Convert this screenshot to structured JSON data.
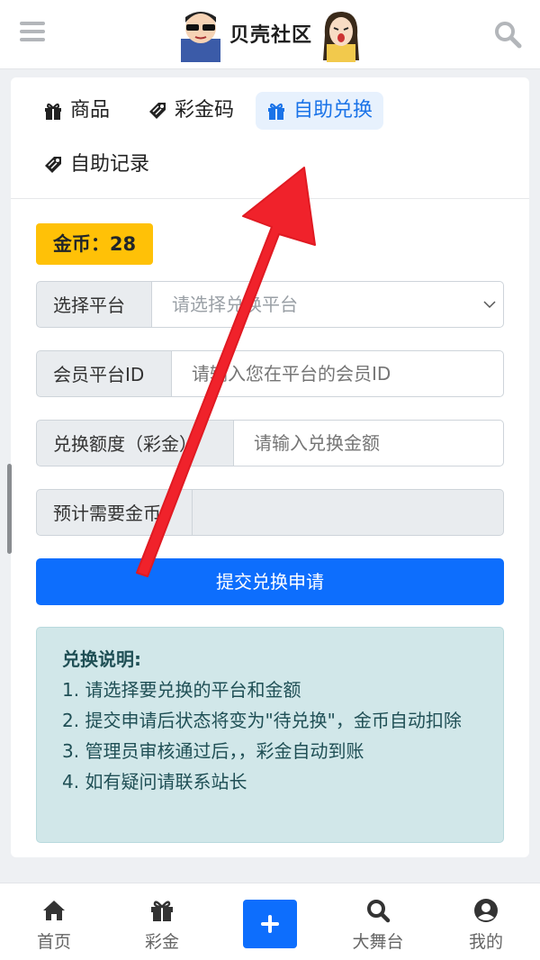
{
  "header": {
    "logo_text": "贝壳社区",
    "menu_icon": "hamburger-icon",
    "search_icon": "search-icon"
  },
  "tabs": [
    {
      "label": "商品",
      "icon": "gift-icon"
    },
    {
      "label": "彩金码",
      "icon": "ticket-icon"
    },
    {
      "label": "自助兑换",
      "icon": "gift-icon",
      "active": true
    },
    {
      "label": "自助记录",
      "icon": "ticket-icon"
    }
  ],
  "coin_badge": "金币：28",
  "form": {
    "platform": {
      "label": "选择平台",
      "placeholder": "请选择兑换平台"
    },
    "member_id": {
      "label": "会员平台ID",
      "placeholder": "请输入您在平台的会员ID"
    },
    "amount": {
      "label": "兑换额度（彩金）",
      "placeholder": "请输入兑换金额"
    },
    "coins_needed": {
      "label": "预计需要金币",
      "value": ""
    }
  },
  "submit_label": "提交兑换申请",
  "notice": {
    "title": "兑换说明:",
    "lines": [
      "1. 请选择要兑换的平台和金额",
      "2. 提交申请后状态将变为\"待兑换\"，金币自动扣除",
      "3. 管理员审核通过后，，彩金自动到账",
      "4. 如有疑问请联系站长"
    ]
  },
  "bottom_nav": [
    {
      "label": "首页",
      "icon": "home-icon"
    },
    {
      "label": "彩金",
      "icon": "gift-icon"
    },
    {
      "label": "",
      "icon": "plus-icon"
    },
    {
      "label": "大舞台",
      "icon": "search-icon"
    },
    {
      "label": "我的",
      "icon": "user-circle-icon"
    }
  ],
  "colors": {
    "primary": "#0d6efd",
    "coin": "#ffc107",
    "notice_bg": "#d1e7e9",
    "arrow": "#f0222b"
  }
}
